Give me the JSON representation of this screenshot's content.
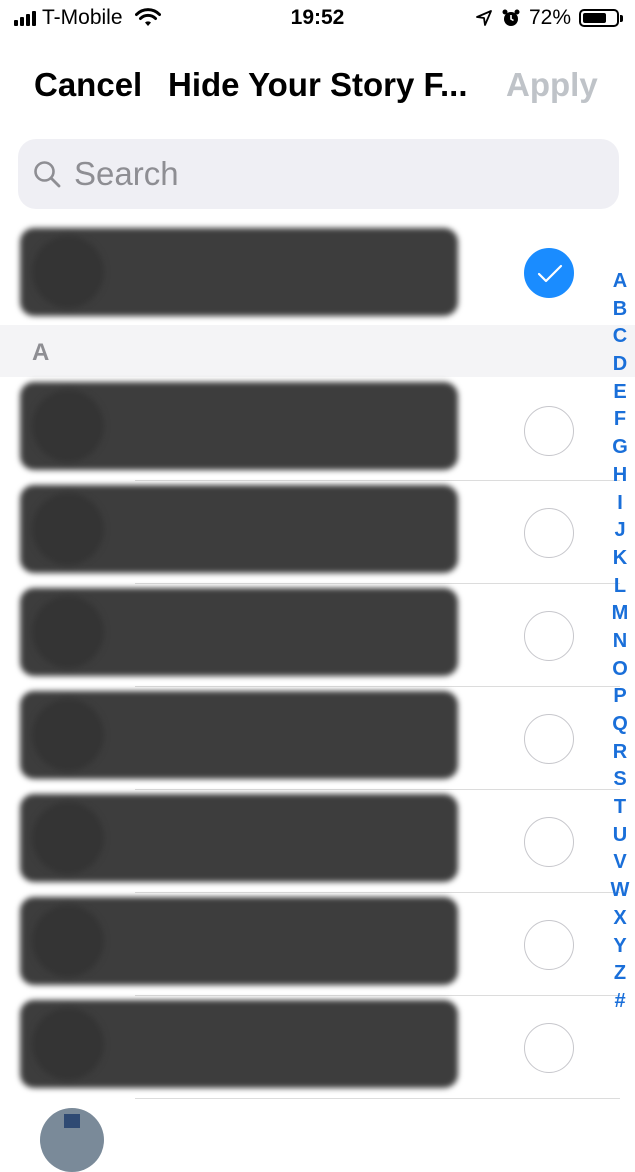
{
  "status_bar": {
    "carrier": "T-Mobile",
    "time": "19:52",
    "battery_percent": "72%",
    "battery_level": 0.72,
    "icons": [
      "signal-icon",
      "wifi-icon",
      "location-arrow-icon",
      "alarm-icon",
      "battery-icon"
    ]
  },
  "nav": {
    "cancel_label": "Cancel",
    "title": "Hide Your Story F...",
    "apply_label": "Apply"
  },
  "search": {
    "placeholder": "Search",
    "value": ""
  },
  "selected_section": {
    "items": [
      {
        "checked": true
      }
    ]
  },
  "section_a": {
    "header": "A",
    "items": [
      {
        "checked": false
      },
      {
        "checked": false
      },
      {
        "checked": false
      },
      {
        "checked": false
      },
      {
        "checked": false
      },
      {
        "checked": false
      },
      {
        "checked": false
      }
    ]
  },
  "index_letters": [
    "A",
    "B",
    "C",
    "D",
    "E",
    "F",
    "G",
    "H",
    "I",
    "J",
    "K",
    "L",
    "M",
    "N",
    "O",
    "P",
    "Q",
    "R",
    "S",
    "T",
    "U",
    "V",
    "W",
    "X",
    "Y",
    "Z",
    "#"
  ],
  "colors": {
    "accent": "#1a8cff",
    "index": "#1a6fd9",
    "apply_disabled": "#bfc3c8",
    "section_bg": "#f4f4f6"
  }
}
